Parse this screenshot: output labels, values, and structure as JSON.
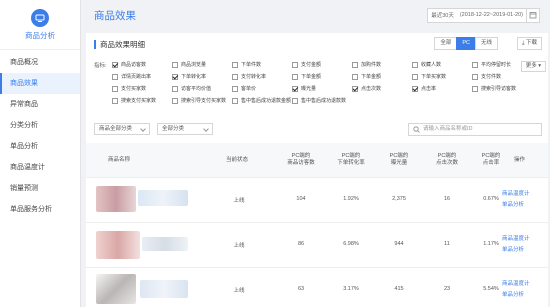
{
  "sidebar": {
    "brand_label": "商品分析",
    "items": [
      {
        "label": "商品概况",
        "active": false
      },
      {
        "label": "商品效果",
        "active": true
      },
      {
        "label": "异常商品",
        "active": false
      },
      {
        "label": "分类分析",
        "active": false
      },
      {
        "label": "单品分析",
        "active": false
      },
      {
        "label": "商品温度计",
        "active": false
      },
      {
        "label": "销量预测",
        "active": false
      },
      {
        "label": "单品服务分析",
        "active": false
      }
    ]
  },
  "header": {
    "title": "商品效果",
    "date_preset": "最近30天",
    "date_range": "(2018-12-22~2019-01-20)"
  },
  "panel": {
    "title": "商品效果明细",
    "device_tabs": [
      "全部",
      "PC",
      "无线"
    ],
    "active_device": "PC",
    "download_label": "下载",
    "indicator_label": "指标:",
    "more_label": "更多",
    "indicators": [
      {
        "label": "商品访客数",
        "checked": true
      },
      {
        "label": "商品浏览量",
        "checked": false
      },
      {
        "label": "下单件数",
        "checked": false
      },
      {
        "label": "支付金额",
        "checked": false
      },
      {
        "label": "加购件数",
        "checked": false
      },
      {
        "label": "收藏人数",
        "checked": false
      },
      {
        "label": "平均停留时长",
        "checked": false
      },
      {
        "label": "详情页跳出率",
        "checked": false
      },
      {
        "label": "下单转化率",
        "checked": true
      },
      {
        "label": "支付转化率",
        "checked": false
      },
      {
        "label": "下单金额",
        "checked": false
      },
      {
        "label": "下单金额",
        "checked": false
      },
      {
        "label": "下单买家数",
        "checked": false
      },
      {
        "label": "支付件数",
        "checked": false
      },
      {
        "label": "支付买家数",
        "checked": false
      },
      {
        "label": "访客平均价值",
        "checked": false
      },
      {
        "label": "客单价",
        "checked": false
      },
      {
        "label": "曝光量",
        "checked": true
      },
      {
        "label": "点击次数",
        "checked": true
      },
      {
        "label": "点击率",
        "checked": true
      },
      {
        "label": "搜索引导访客数",
        "checked": false
      },
      {
        "label": "搜索支付买家数",
        "checked": false
      },
      {
        "label": "搜索引导支付买家数",
        "checked": false
      },
      {
        "label": "售中售后成功退款金额",
        "checked": false
      },
      {
        "label": "售中售后成功退款数",
        "checked": false
      }
    ],
    "filters": {
      "category1": "商品全部分类",
      "category2": "全部分类",
      "search_placeholder": "请输入商品名称或ID"
    },
    "columns": {
      "name": "商品名称",
      "status": "当前状态",
      "visitors": "PC端的\n商品访客数",
      "conv": "PC端的\n下单转化率",
      "expo": "PC端的\n曝光量",
      "clicks": "PC端的\n点击次数",
      "ctr": "PC端的\n点击率",
      "action": "操作"
    },
    "rows": [
      {
        "status": "上线",
        "visitors": "104",
        "conv": "1.92%",
        "expo": "2,375",
        "clicks": "16",
        "ctr": "0.67%",
        "link1": "商品温度计",
        "link2": "单品分析"
      },
      {
        "status": "上线",
        "visitors": "86",
        "conv": "6.98%",
        "expo": "944",
        "clicks": "11",
        "ctr": "1.17%",
        "link1": "商品温度计",
        "link2": "单品分析"
      },
      {
        "status": "上线",
        "visitors": "63",
        "conv": "3.17%",
        "expo": "415",
        "clicks": "23",
        "ctr": "5.54%",
        "link1": "商品温度计",
        "link2": "单品分析"
      }
    ]
  },
  "colors": {
    "accent": "#3b7de9"
  }
}
